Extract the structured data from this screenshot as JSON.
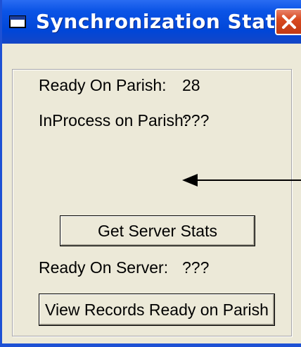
{
  "window": {
    "title": "Synchronization Status"
  },
  "fields": {
    "ready_on_parish_label": "Ready On Parish:",
    "ready_on_parish_value": "28",
    "inprocess_on_parish_label": "InProcess on Parish:",
    "inprocess_on_parish_value": "???",
    "ready_on_server_label": "Ready On Server:",
    "ready_on_server_value": "???"
  },
  "buttons": {
    "get_server_stats": "Get Server Stats",
    "view_records": "View Records Ready on Parish"
  },
  "icons": {
    "app": "window-icon",
    "close": "close-icon",
    "annotation": "arrow-left-icon"
  },
  "colors": {
    "titlebar": "#0a55e4",
    "close_button": "#d8491f",
    "window_face": "#ece9d8"
  }
}
